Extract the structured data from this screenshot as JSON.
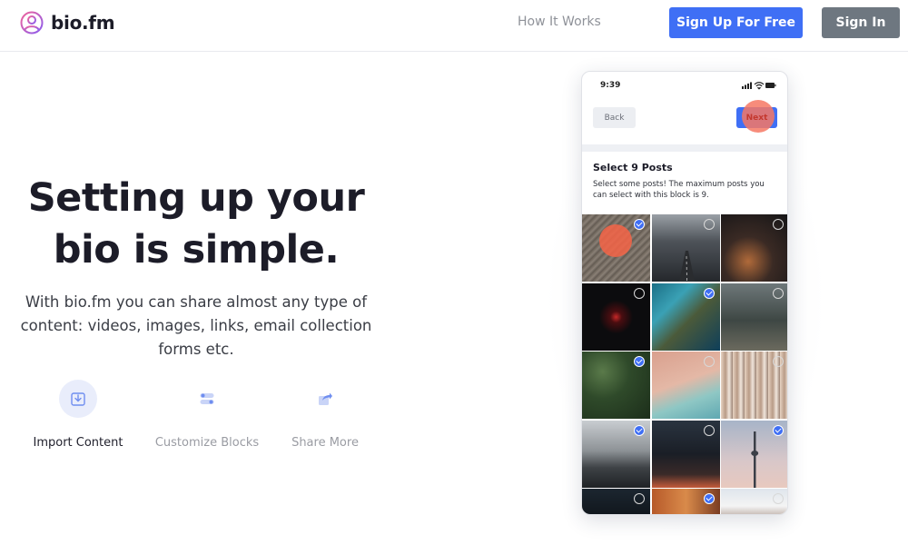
{
  "header": {
    "logo_text": "bio.fm",
    "nav_link": "How It Works",
    "signup_label": "Sign Up For Free",
    "signin_label": "Sign In",
    "accent_color": "#3f6ff5"
  },
  "hero": {
    "title_line1": "Setting up your",
    "title_line2": "bio is simple.",
    "description": "With bio.fm you can share almost any type of content: videos, images, links, email collection forms etc."
  },
  "features": [
    {
      "label": "Import Content",
      "icon": "download-box-icon",
      "active": true
    },
    {
      "label": "Customize Blocks",
      "icon": "toggle-icon",
      "active": false
    },
    {
      "label": "Share More",
      "icon": "share-arrow-icon",
      "active": false
    }
  ],
  "phone": {
    "time": "9:39",
    "back_label": "Back",
    "next_label": "Next",
    "select_title": "Select 9 Posts",
    "select_desc": "Select some posts! The maximum posts you can select with this block is 9.",
    "posts": [
      {
        "subject": "elephant skin",
        "selected": true
      },
      {
        "subject": "mountain road",
        "selected": false
      },
      {
        "subject": "city lights aerial",
        "selected": false
      },
      {
        "subject": "red light in dark",
        "selected": false
      },
      {
        "subject": "coastal aerial",
        "selected": true
      },
      {
        "subject": "forest path",
        "selected": false
      },
      {
        "subject": "green leaves",
        "selected": true
      },
      {
        "subject": "beach aerial",
        "selected": false
      },
      {
        "subject": "wooden poles",
        "selected": false
      },
      {
        "subject": "lake pier",
        "selected": true
      },
      {
        "subject": "city street night",
        "selected": false
      },
      {
        "subject": "tv tower",
        "selected": true
      },
      {
        "subject": "dark water",
        "selected": false
      },
      {
        "subject": "orange city",
        "selected": true
      },
      {
        "subject": "snowy landscape",
        "selected": false
      }
    ]
  }
}
